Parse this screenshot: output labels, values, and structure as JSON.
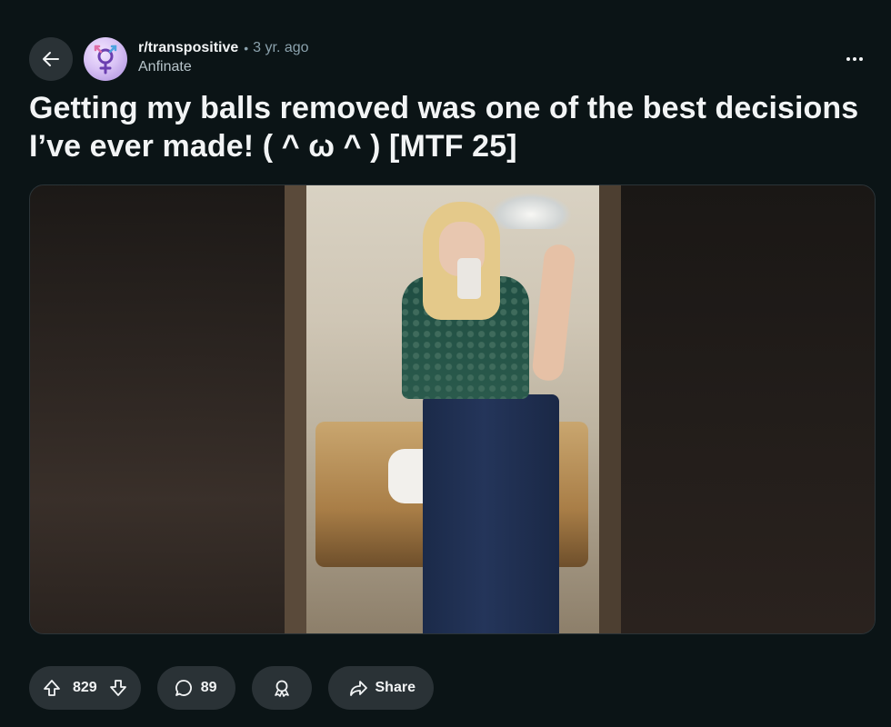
{
  "post": {
    "subreddit": "r/transpositive",
    "separator": "•",
    "time": "3 yr. ago",
    "author": "Anfinate",
    "title": "Getting my balls removed was one of the best decisions I’ve ever made!   ( ^ ω ^ )  [MTF 25]"
  },
  "actions": {
    "upvotes": "829",
    "comments": "89",
    "share_label": "Share"
  },
  "icons": {
    "back": "back-arrow-icon",
    "more": "more-options-icon",
    "upvote": "upvote-arrow-icon",
    "downvote": "downvote-arrow-icon",
    "comment": "comment-bubble-icon",
    "award": "award-icon",
    "share": "share-arrow-icon"
  },
  "colors": {
    "background": "#0b1416",
    "pill": "#2a3236",
    "text": "#f2f4f5",
    "muted": "#8ba2ad"
  }
}
